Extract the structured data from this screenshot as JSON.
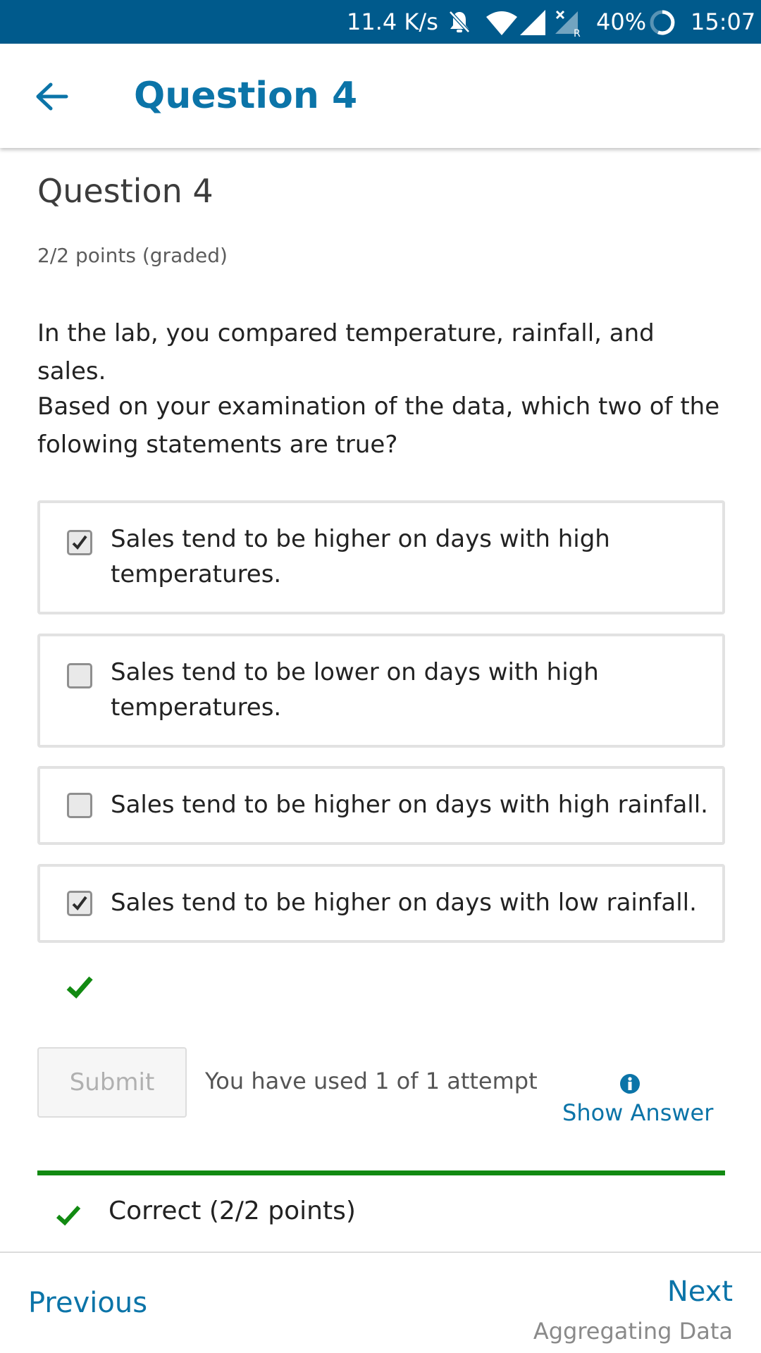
{
  "status_bar": {
    "speed": "11.4 K/s",
    "battery": "40%",
    "time": "15:07",
    "icons": [
      "mute-bell-icon",
      "wifi-icon",
      "signal-icon",
      "no-signal-roaming-icon",
      "battery-ring-icon"
    ]
  },
  "app_bar": {
    "title": "Question 4",
    "back_icon": "arrow-left-icon"
  },
  "question": {
    "heading": "Question 4",
    "points": "2/2 points (graded)",
    "prompt_line1": "In the lab, you compared temperature, rainfall, and sales.",
    "prompt_line2": "Based on your examination of the data, which two of the folowing statements are true?"
  },
  "options": [
    {
      "label": "Sales tend to be higher on days with high temperatures.",
      "checked": true
    },
    {
      "label": "Sales tend to be lower on days with high temperatures.",
      "checked": false
    },
    {
      "label": "Sales tend to be higher on days with high rainfall.",
      "checked": false
    },
    {
      "label": "Sales tend to be higher on days with low rainfall.",
      "checked": true
    }
  ],
  "actions": {
    "submit_label": "Submit",
    "attempts_text": "You have used 1 of 1 attempt",
    "show_answer_label": "Show Answer",
    "info_icon": "info-circle-icon"
  },
  "result": {
    "text": "Correct (2/2 points)",
    "color": "#128a12"
  },
  "footer": {
    "previous_label": "Previous",
    "next_label": "Next",
    "next_subtitle": "Aggregating Data"
  },
  "colors": {
    "status_bar": "#005a8c",
    "accent": "#0b74a8",
    "correct": "#128a12"
  }
}
